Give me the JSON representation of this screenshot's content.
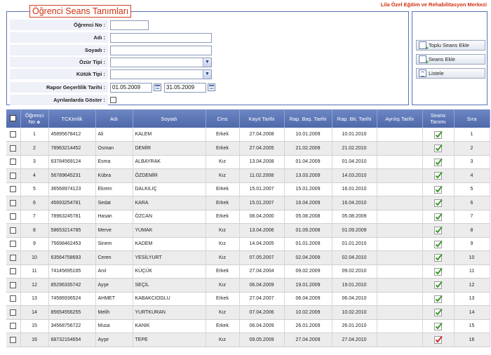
{
  "header": {
    "org_name": "Lila Özel Eğitim ve Rehabilitasyon Merkezi"
  },
  "form": {
    "legend": "Öğrenci Seans Tanımları",
    "labels": {
      "ogrenci_no": "Öğrenci No :",
      "adi": "Adı :",
      "soyadi": "Soyadı :",
      "ozur_tipi": "Özür Tipi :",
      "kutuk_tipi": "Kütük Tipi :",
      "rapor": "Rapor Geçerlilik Tarihi :",
      "ayrilanlarda": "Ayrılanlarda Göster :"
    },
    "values": {
      "ogrenci_no": "",
      "adi": "",
      "soyadi": "",
      "ozur_tipi": "",
      "kutuk_tipi": "",
      "rapor_baslangic": "01.05.2009",
      "rapor_bitis": "31.05.2009"
    }
  },
  "actions": {
    "toplu": "Toplu Seans Ekle",
    "seans": "Seans Ekle",
    "listele": "Listele"
  },
  "grid": {
    "headers": [
      "Öğrenci No",
      "TCKimlik",
      "Adı",
      "Soyadı",
      "Cins",
      "Kayıt Tarihi",
      "Rap. Baş. Tarihi",
      "Rap. Bit. Tarihi",
      "Ayrılış Tarihi",
      "Seans Tanımı",
      "Sıra"
    ],
    "rows": [
      {
        "no": "1",
        "tc": "45895678412",
        "adi": "Ali",
        "soyadi": "KALEM",
        "cins": "Erkek",
        "kayit": "27.04.2008",
        "rap_bas": "10.01.2009",
        "rap_bit": "10.01.2010",
        "ayrilis": "",
        "seans": "green",
        "sira": "1"
      },
      {
        "no": "2",
        "tc": "78963214452",
        "adi": "Osman",
        "soyadi": "DEMİR",
        "cins": "Erkek",
        "kayit": "27.04.2005",
        "rap_bas": "21.02.2009",
        "rap_bit": "21.02.2010",
        "ayrilis": "",
        "seans": "green",
        "sira": "2"
      },
      {
        "no": "3",
        "tc": "63784569124",
        "adi": "Esma",
        "soyadi": "ALBAYRAK",
        "cins": "Kız",
        "kayit": "13.04.2008",
        "rap_bas": "01.04.2009",
        "rap_bit": "01.04.2010",
        "ayrilis": "",
        "seans": "green",
        "sira": "3"
      },
      {
        "no": "4",
        "tc": "56789645231",
        "adi": "Kübra",
        "soyadi": "ÖZDEMİR",
        "cins": "Kız",
        "kayit": "11.02.2008",
        "rap_bas": "13.03.2009",
        "rap_bit": "14.03.2010",
        "ayrilis": "",
        "seans": "green",
        "sira": "4"
      },
      {
        "no": "5",
        "tc": "36568974123",
        "adi": "Ekrem",
        "soyadi": "DALKILIÇ",
        "cins": "Erkek",
        "kayit": "15.01.2007",
        "rap_bas": "15.01.2009",
        "rap_bit": "16.01.2010",
        "ayrilis": "",
        "seans": "green",
        "sira": "5"
      },
      {
        "no": "6",
        "tc": "45693254781",
        "adi": "Sedat",
        "soyadi": "KARA",
        "cins": "Erkek",
        "kayit": "15.01.2007",
        "rap_bas": "16.04.2009",
        "rap_bit": "16.04.2010",
        "ayrilis": "",
        "seans": "green",
        "sira": "6"
      },
      {
        "no": "7",
        "tc": "78963245781",
        "adi": "Hasan",
        "soyadi": "ÖZCAN",
        "cins": "Erkek",
        "kayit": "08.04.2000",
        "rap_bas": "05.08.2008",
        "rap_bit": "05.08.2009",
        "ayrilis": "",
        "seans": "green",
        "sira": "7"
      },
      {
        "no": "8",
        "tc": "58653214785",
        "adi": "Merve",
        "soyadi": "YUMAK",
        "cins": "Kız",
        "kayit": "13.04.2006",
        "rap_bas": "01.09.2008",
        "rap_bit": "01.09.2009",
        "ayrilis": "",
        "seans": "green",
        "sira": "8"
      },
      {
        "no": "9",
        "tc": "75698462453",
        "adi": "Sinem",
        "soyadi": "KADEM",
        "cins": "Kız",
        "kayit": "14.04.2005",
        "rap_bas": "01.01.2009",
        "rap_bit": "01.01.2010",
        "ayrilis": "",
        "seans": "green",
        "sira": "9"
      },
      {
        "no": "10",
        "tc": "63564758693",
        "adi": "Ceren",
        "soyadi": "YESİLYURT",
        "cins": "Kız",
        "kayit": "07.05.2007",
        "rap_bas": "02.04.2009",
        "rap_bit": "02.04.2010",
        "ayrilis": "",
        "seans": "green",
        "sira": "10"
      },
      {
        "no": "11",
        "tc": "74145695165",
        "adi": "Anıl",
        "soyadi": "KÜÇÜK",
        "cins": "Erkek",
        "kayit": "27.04.2004",
        "rap_bas": "09.02.2009",
        "rap_bit": "09.02.2010",
        "ayrilis": "",
        "seans": "green",
        "sira": "11"
      },
      {
        "no": "12",
        "tc": "85296335742",
        "adi": "Ayşe",
        "soyadi": "SEÇİL",
        "cins": "Kız",
        "kayit": "06.04.2009",
        "rap_bas": "19.01.2009",
        "rap_bit": "19.01.2010",
        "ayrilis": "",
        "seans": "green",
        "sira": "12"
      },
      {
        "no": "13",
        "tc": "74586936524",
        "adi": "AHMET",
        "soyadi": "KABAKCIOGLU",
        "cins": "Erkek",
        "kayit": "27.04.2007",
        "rap_bas": "06.04.2009",
        "rap_bit": "06.04.2010",
        "ayrilis": "",
        "seans": "green",
        "sira": "13"
      },
      {
        "no": "14",
        "tc": "85654556255",
        "adi": "Melih",
        "soyadi": "YURTKURAN",
        "cins": "Kız",
        "kayit": "07.04.2006",
        "rap_bas": "10.02.2009",
        "rap_bit": "10.02.2010",
        "ayrilis": "",
        "seans": "green",
        "sira": "14"
      },
      {
        "no": "15",
        "tc": "34568756722",
        "adi": "Musa",
        "soyadi": "KANIK",
        "cins": "Erkek",
        "kayit": "06.04.2009",
        "rap_bas": "26.01.2009",
        "rap_bit": "26.01.2010",
        "ayrilis": "",
        "seans": "green",
        "sira": "15"
      },
      {
        "no": "16",
        "tc": "68732154654",
        "adi": "Ayşe",
        "soyadi": "TEPE",
        "cins": "Kız",
        "kayit": "09.05.2009",
        "rap_bas": "27.04.2009",
        "rap_bit": "27.04.2010",
        "ayrilis": "",
        "seans": "red",
        "sira": "16"
      }
    ]
  },
  "colors": {
    "header_blue": "#5a74b4",
    "accent_red": "#d03010",
    "check_green": "#3a9a2a",
    "check_red": "#d42020"
  },
  "icons": {
    "calendar": "calendar-icon",
    "dropdown": "chevron-down-icon",
    "add": "add-document-icon",
    "list": "list-icon",
    "check": "check-icon"
  }
}
